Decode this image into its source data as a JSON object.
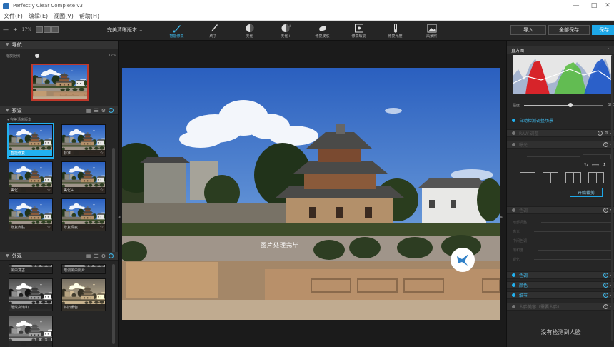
{
  "window": {
    "title": "Perfectly Clear Complete v3",
    "minimize": "—",
    "maximize": "□",
    "close": "✕"
  },
  "menu": [
    "文件(F)",
    "编辑(E)",
    "视图(V)",
    "帮助(H)"
  ],
  "toolbar": {
    "zoom_out": "—",
    "zoom_in": "+",
    "zoom_level": "17%",
    "preset_select": "完美清晰版本 ⌄",
    "tools": [
      {
        "label": "智能修复",
        "active": true,
        "icon": "brush-icon"
      },
      {
        "label": "刷子",
        "active": false,
        "icon": "paintbrush-icon"
      },
      {
        "label": "美化",
        "active": false,
        "icon": "face-icon"
      },
      {
        "label": "美化+",
        "active": false,
        "icon": "face-plus-icon"
      },
      {
        "label": "修复皮肤",
        "active": false,
        "icon": "eraser-icon"
      },
      {
        "label": "修复瑕疵",
        "active": false,
        "icon": "spot-icon"
      },
      {
        "label": "修复光度",
        "active": false,
        "icon": "thermometer-icon"
      },
      {
        "label": "风景照",
        "active": false,
        "icon": "landscape-icon"
      }
    ],
    "right_buttons": [
      {
        "label": "导入",
        "accent": false
      },
      {
        "label": "全部保存",
        "accent": false
      },
      {
        "label": "保存",
        "accent": true
      }
    ]
  },
  "left": {
    "navigator": {
      "title": "导航",
      "zoom_label": "缩放比例",
      "zoom_value": "17%",
      "zoom_fraction": 0.17
    },
    "presets": {
      "title": "预设",
      "subtitle": "完美清晰版本",
      "items": [
        {
          "label": "智能修复",
          "selected": true
        },
        {
          "label": "标准",
          "selected": false
        },
        {
          "label": "美化",
          "selected": false
        },
        {
          "label": "美化+",
          "selected": false
        },
        {
          "label": "修复皮肤",
          "selected": false
        },
        {
          "label": "修复瑕疵",
          "selected": false
        }
      ]
    },
    "looks": {
      "title": "外观",
      "items": [
        {
          "label": "黑白复古",
          "selected": false
        },
        {
          "label": "暗调黑白照片",
          "selected": false
        },
        {
          "label": "酷炫高饱和",
          "selected": false
        },
        {
          "label": "怀旧暖色",
          "selected": false
        },
        {
          "label": "",
          "selected": false
        }
      ]
    }
  },
  "center": {
    "overlay_text": "图片处理完毕"
  },
  "right": {
    "histogram": {
      "title": "直方图"
    },
    "strength": {
      "label": "强度",
      "value": "100",
      "fraction": 0.58
    },
    "auto_label": "自动选择场景",
    "auto_sub": "自动检测调整场景",
    "sections": [
      {
        "label": "RAW 调整",
        "active": false,
        "color": "#777777"
      },
      {
        "label": "曝光",
        "active": false,
        "color": "#777777"
      },
      {
        "label": "色调",
        "active": false,
        "color": "#777777"
      },
      {
        "label": "色调",
        "active": true,
        "color": "#21b1ef"
      },
      {
        "label": "颜色",
        "active": true,
        "color": "#21b1ef"
      },
      {
        "label": "细节",
        "active": true,
        "color": "#21b1ef"
      },
      {
        "label": "人脸美容（需要人脸）",
        "active": false,
        "color": "#777777"
      }
    ],
    "start_button": "开始裁剪",
    "tone_rows": [
      "暗部调整",
      "高光",
      "中间色调",
      "饱和度",
      "锐化"
    ],
    "no_face": "没有检测到人脸"
  },
  "colors": {
    "accent": "#1ea8e8",
    "panel": "#262626",
    "sky_top": "#2a5fbf",
    "sky_bottom": "#8ab8e6"
  }
}
